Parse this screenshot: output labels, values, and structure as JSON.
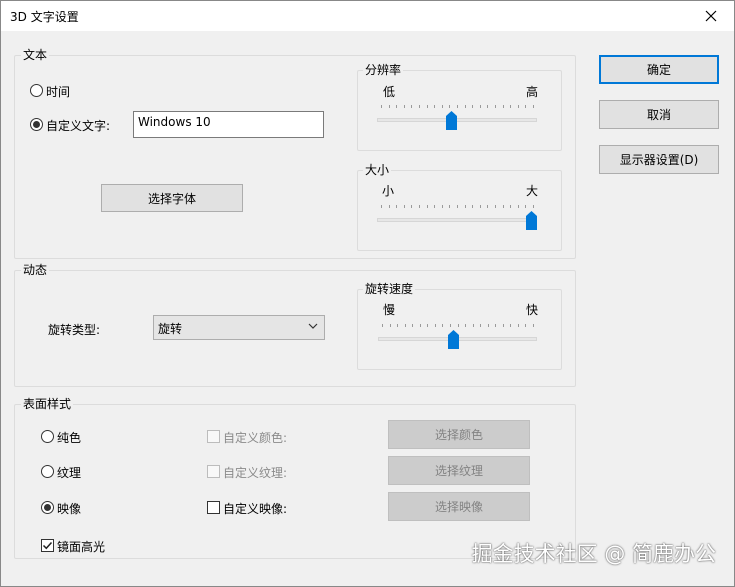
{
  "window": {
    "title": "3D 文字设置"
  },
  "buttons": {
    "ok": "确定",
    "cancel": "取消",
    "display_settings": "显示器设置(D)",
    "choose_font": "选择字体",
    "choose_color": "选择颜色",
    "choose_texture": "选择纹理",
    "choose_reflection": "选择映像"
  },
  "text_group": {
    "label": "文本",
    "time_label": "时间",
    "custom_text_label": "自定义文字:",
    "custom_text_value": "Windows 10",
    "selected": "custom"
  },
  "resolution": {
    "label": "分辨率",
    "low": "低",
    "high": "高",
    "value": 0.46
  },
  "size": {
    "label": "大小",
    "small": "小",
    "large": "大",
    "value": 1.0
  },
  "motion_group": {
    "label": "动态",
    "rotation_type_label": "旋转类型:",
    "rotation_type_value": "旋转"
  },
  "rotation_speed": {
    "label": "旋转速度",
    "slow": "慢",
    "fast": "快",
    "value": 0.47
  },
  "surface_group": {
    "label": "表面样式",
    "solid": "纯色",
    "texture": "纹理",
    "reflection": "映像",
    "selected": "reflection",
    "custom_color": "自定义颜色:",
    "custom_texture": "自定义纹理:",
    "custom_reflection": "自定义映像:",
    "specular": "镜面高光",
    "specular_checked": true
  },
  "watermark": "掘金技术社区 @ 简鹿办公",
  "colors": {
    "accent": "#0078d7",
    "background": "#f0f0f0"
  }
}
